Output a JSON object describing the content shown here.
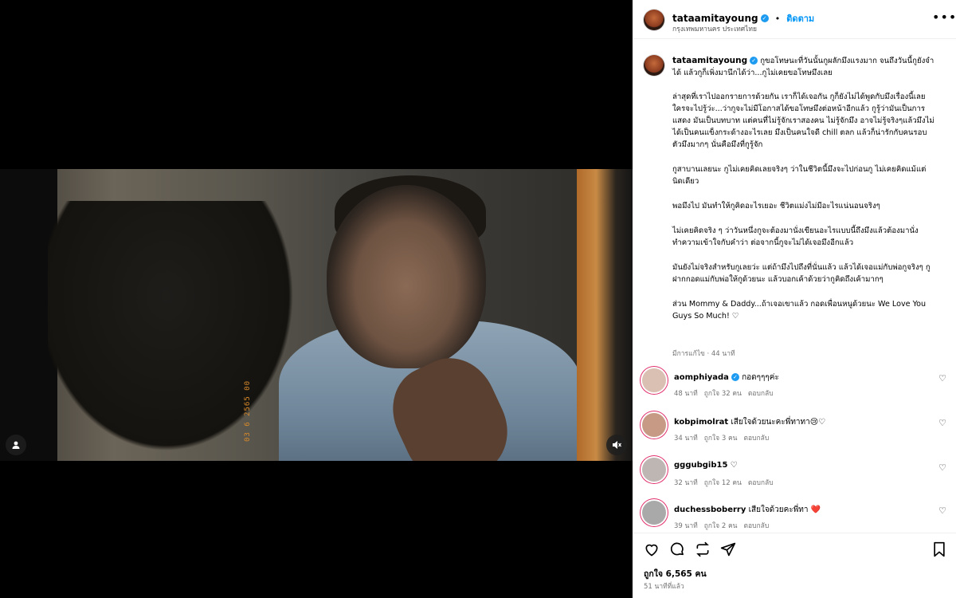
{
  "post": {
    "username": "tataamitayoung",
    "location": "กรุงเทพมหานคร ประเทศไทย",
    "follow_label": "ติดตาม",
    "more": "•••"
  },
  "video": {
    "date_stamp": "03 6 2565 00",
    "accent_color": "#d98a2a"
  },
  "caption": {
    "username": "tataamitayoung",
    "first": "กูขอโทษนะที่วันนั้นกูผลักมึงแรงมาก จนถึงวันนี้กูยังจำได้ แล้วกูก็เพิ่งมานึกได้ว่า...กูไม่เคยขอโทษมึงเลย",
    "paragraphs": [
      "ล่าสุดที่เราไปออกรายการด้วยกัน เราก็ได้เจอกัน กูก็ยังไม่ได้พูดกับมึงเรื่องนี้เลย ใครจะไปรู้ว่ะ...ว่ากูจะไม่มีโอกาสได้ขอโทษมึงต่อหน้าอีกแล้ว กูรู้ว่ามันเป็นการแสดง มันเป็นบทบาท แต่คนที่ไม่รู้จักเราสองคน ไม่รู้จักมึง อาจไม่รู้จริงๆแล้วมึงไม่ได้เป็นคนแข็งกระด้างอะไรเลย มึงเป็นคนใจดี chill ตลก แล้วก็น่ารักกับคนรอบตัวมึงมากๆ นั่นคือมึงที่กูรู้จัก",
      "กูสาบานเลยนะ กูไม่เคยคิดเลยจริงๆ ว่าในชีวิตนี้มึงจะไปก่อนกู ไม่เคยคิดแม้แต่นิดเดียว",
      "พอมึงไป มันทำให้กูคิดอะไรเยอะ ชีวิตแม่งไม่มีอะไรแน่นอนจริงๆ",
      "ไม่เคยคิดจริง ๆ ว่าวันหนึ่งกูจะต้องมานั่งเขียนอะไรแบบนี้ถึงมึงแล้วต้องมานั่งทำความเข้าใจกับคำว่า ต่อจากนี้กูจะไม่ได้เจอมึงอีกแล้ว",
      "มันยังไม่จริงสำหรับกูเลยว่ะ แต่ถ้ามึงไปถึงที่นั่นแล้ว แล้วได้เจอแม่กับพ่อกูจริงๆ กูฝากกอดแม่กับพ่อให้กูด้วยนะ แล้วบอกเค้าด้วยว่ากูคิดถึงเค้ามากๆ",
      "ส่วน Mommy & Daddy...ถ้าเจอเขาแล้ว กอดเพื่อนหนูด้วยนะ We Love You Guys So Much! ♡"
    ],
    "meta": "มีการแก้ไข · 44 นาที"
  },
  "comments": [
    {
      "user": "aomphiyada",
      "verified": true,
      "text": "กอดๆๆๆค่ะ",
      "time": "48 นาที",
      "likes": "ถูกใจ 32 คน",
      "reply": "ตอบกลับ",
      "color": "#d9c0b2"
    },
    {
      "user": "kobpimolrat",
      "verified": false,
      "text": "เสียใจด้วยนะคะพี่ทาทา😢♡",
      "time": "34 นาที",
      "likes": "ถูกใจ 3 คน",
      "reply": "ตอบกลับ",
      "color": "#c79a86"
    },
    {
      "user": "gggubgib15",
      "verified": false,
      "text": "♡",
      "time": "32 นาที",
      "likes": "ถูกใจ 12 คน",
      "reply": "ตอบกลับ",
      "color": "#bdb6b2"
    },
    {
      "user": "duchessboberry",
      "verified": false,
      "text": "เสียใจด้วยคะพี่ทา ❤️",
      "time": "39 นาที",
      "likes": "ถูกใจ 2 คน",
      "reply": "ตอบกลับ",
      "color": "#a9a9a9"
    }
  ],
  "stats": {
    "likes": "ถูกใจ 6,565 คน",
    "time": "51 นาทีที่แล้ว"
  },
  "icons": {
    "like": "heart-icon",
    "comment": "comment-icon",
    "share": "share-icon",
    "repost": "repost-icon",
    "save": "bookmark-icon"
  },
  "colors": {
    "verified": "#1d9bf0",
    "link": "#0095f6",
    "muted": "#737373"
  }
}
